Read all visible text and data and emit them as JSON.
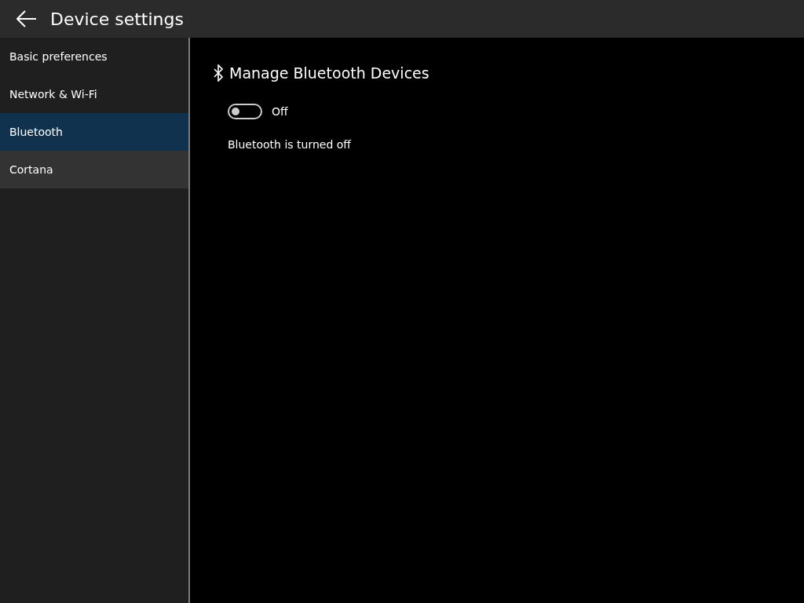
{
  "header": {
    "title": "Device settings"
  },
  "sidebar": {
    "items": [
      {
        "label": "Basic preferences",
        "selected": false,
        "hovered": false
      },
      {
        "label": "Network & Wi-Fi",
        "selected": false,
        "hovered": false
      },
      {
        "label": "Bluetooth",
        "selected": true,
        "hovered": false
      },
      {
        "label": "Cortana",
        "selected": false,
        "hovered": true
      }
    ]
  },
  "panel": {
    "title": "Manage Bluetooth Devices",
    "toggle": {
      "on": false,
      "label": "Off"
    },
    "status": "Bluetooth is turned off"
  }
}
